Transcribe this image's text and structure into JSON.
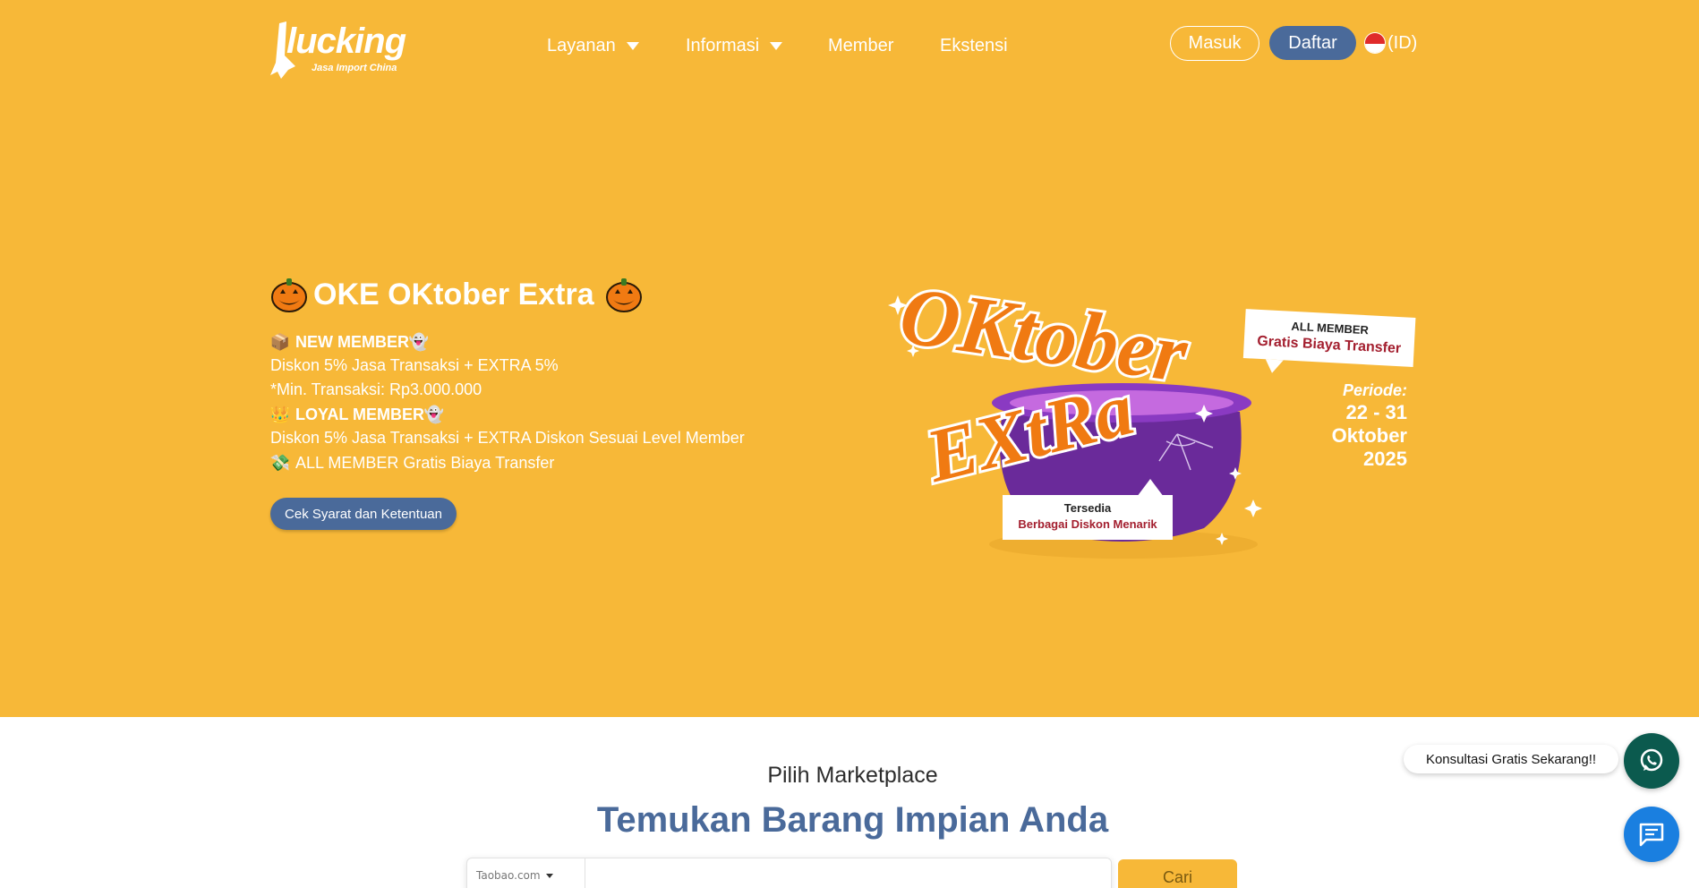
{
  "brand": {
    "name": "lucking",
    "tagline": "Jasa Import China",
    "primary_color": "#f7b838",
    "accent_color": "#4a6a9a"
  },
  "nav": {
    "items": [
      {
        "label": "Layanan",
        "has_dropdown": true
      },
      {
        "label": "Informasi",
        "has_dropdown": true
      },
      {
        "label": "Member",
        "has_dropdown": false
      },
      {
        "label": "Ekstensi",
        "has_dropdown": false
      }
    ],
    "login_label": "Masuk",
    "register_label": "Daftar",
    "language_label": "(ID)"
  },
  "promo": {
    "title": "OKE OKtober Extra",
    "new_member_label": "NEW MEMBER",
    "new_member_line1": "Diskon 5% Jasa Transaksi + EXTRA 5%",
    "new_member_line2": "*Min. Transaksi: Rp3.000.000",
    "loyal_member_label": "LOYAL MEMBER",
    "loyal_member_line": "Diskon 5% Jasa Transaksi + EXTRA Diskon Sesuai Level Member",
    "all_member_line": "ALL MEMBER Gratis Biaya Transfer",
    "cta_label": "Cek Syarat dan Ketentuan"
  },
  "banner": {
    "headline_1": "OKtober",
    "headline_2": "EXtRa",
    "tag_all_member": "ALL MEMBER",
    "tag_transfer": "Gratis Biaya Transfer",
    "period_label": "Periode:",
    "period_dates": "22 - 31",
    "period_month": "Oktober",
    "period_year": "2025",
    "bubble_line1": "Tersedia",
    "bubble_line2": "Berbagai Diskon Menarik"
  },
  "marketplace": {
    "subtitle": "Pilih Marketplace",
    "title": "Temukan Barang Impian Anda",
    "selected_marketplace": "Taobao.com",
    "search_placeholder": "",
    "search_button_label": "Cari"
  },
  "floating": {
    "consult_label": "Konsultasi Gratis Sekarang!!"
  }
}
